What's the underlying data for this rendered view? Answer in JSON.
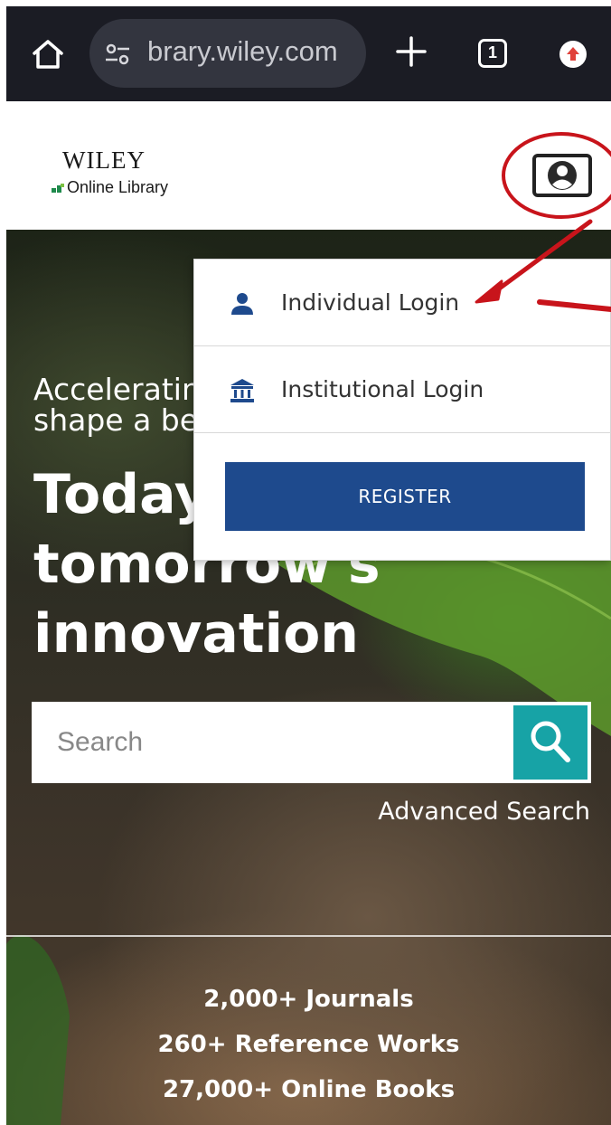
{
  "browser": {
    "url_text": "brary.wiley.com",
    "tab_count": "1",
    "icons": [
      "home-icon",
      "site-settings-icon",
      "new-tab-icon",
      "tab-switcher-icon",
      "update-icon"
    ]
  },
  "header": {
    "logo_title": "WILEY",
    "logo_subtitle": "Online Library",
    "account_icon": "account-icon"
  },
  "dropdown": {
    "items": [
      {
        "label": "Individual Login",
        "icon": "person-icon"
      },
      {
        "label": "Institutional Login",
        "icon": "institution-icon"
      }
    ],
    "register_label": "REGISTER"
  },
  "hero": {
    "subtitle_line1": "Accelerating research discovery to",
    "subtitle_line2": "shape a better future",
    "title_line1": "Today's research,",
    "title_line2": "tomorrow's",
    "title_line3": "innovation",
    "search_placeholder": "Search",
    "advanced_search": "Advanced Search",
    "stats": [
      "2,000+ Journals",
      "260+ Reference Works",
      "27,000+ Online Books"
    ]
  },
  "colors": {
    "browser_bar": "#1b1c24",
    "register_button": "#1e4a8d",
    "search_button": "#17a3a6",
    "annotation": "#c8141b",
    "icon_blue": "#1e4a8d"
  }
}
